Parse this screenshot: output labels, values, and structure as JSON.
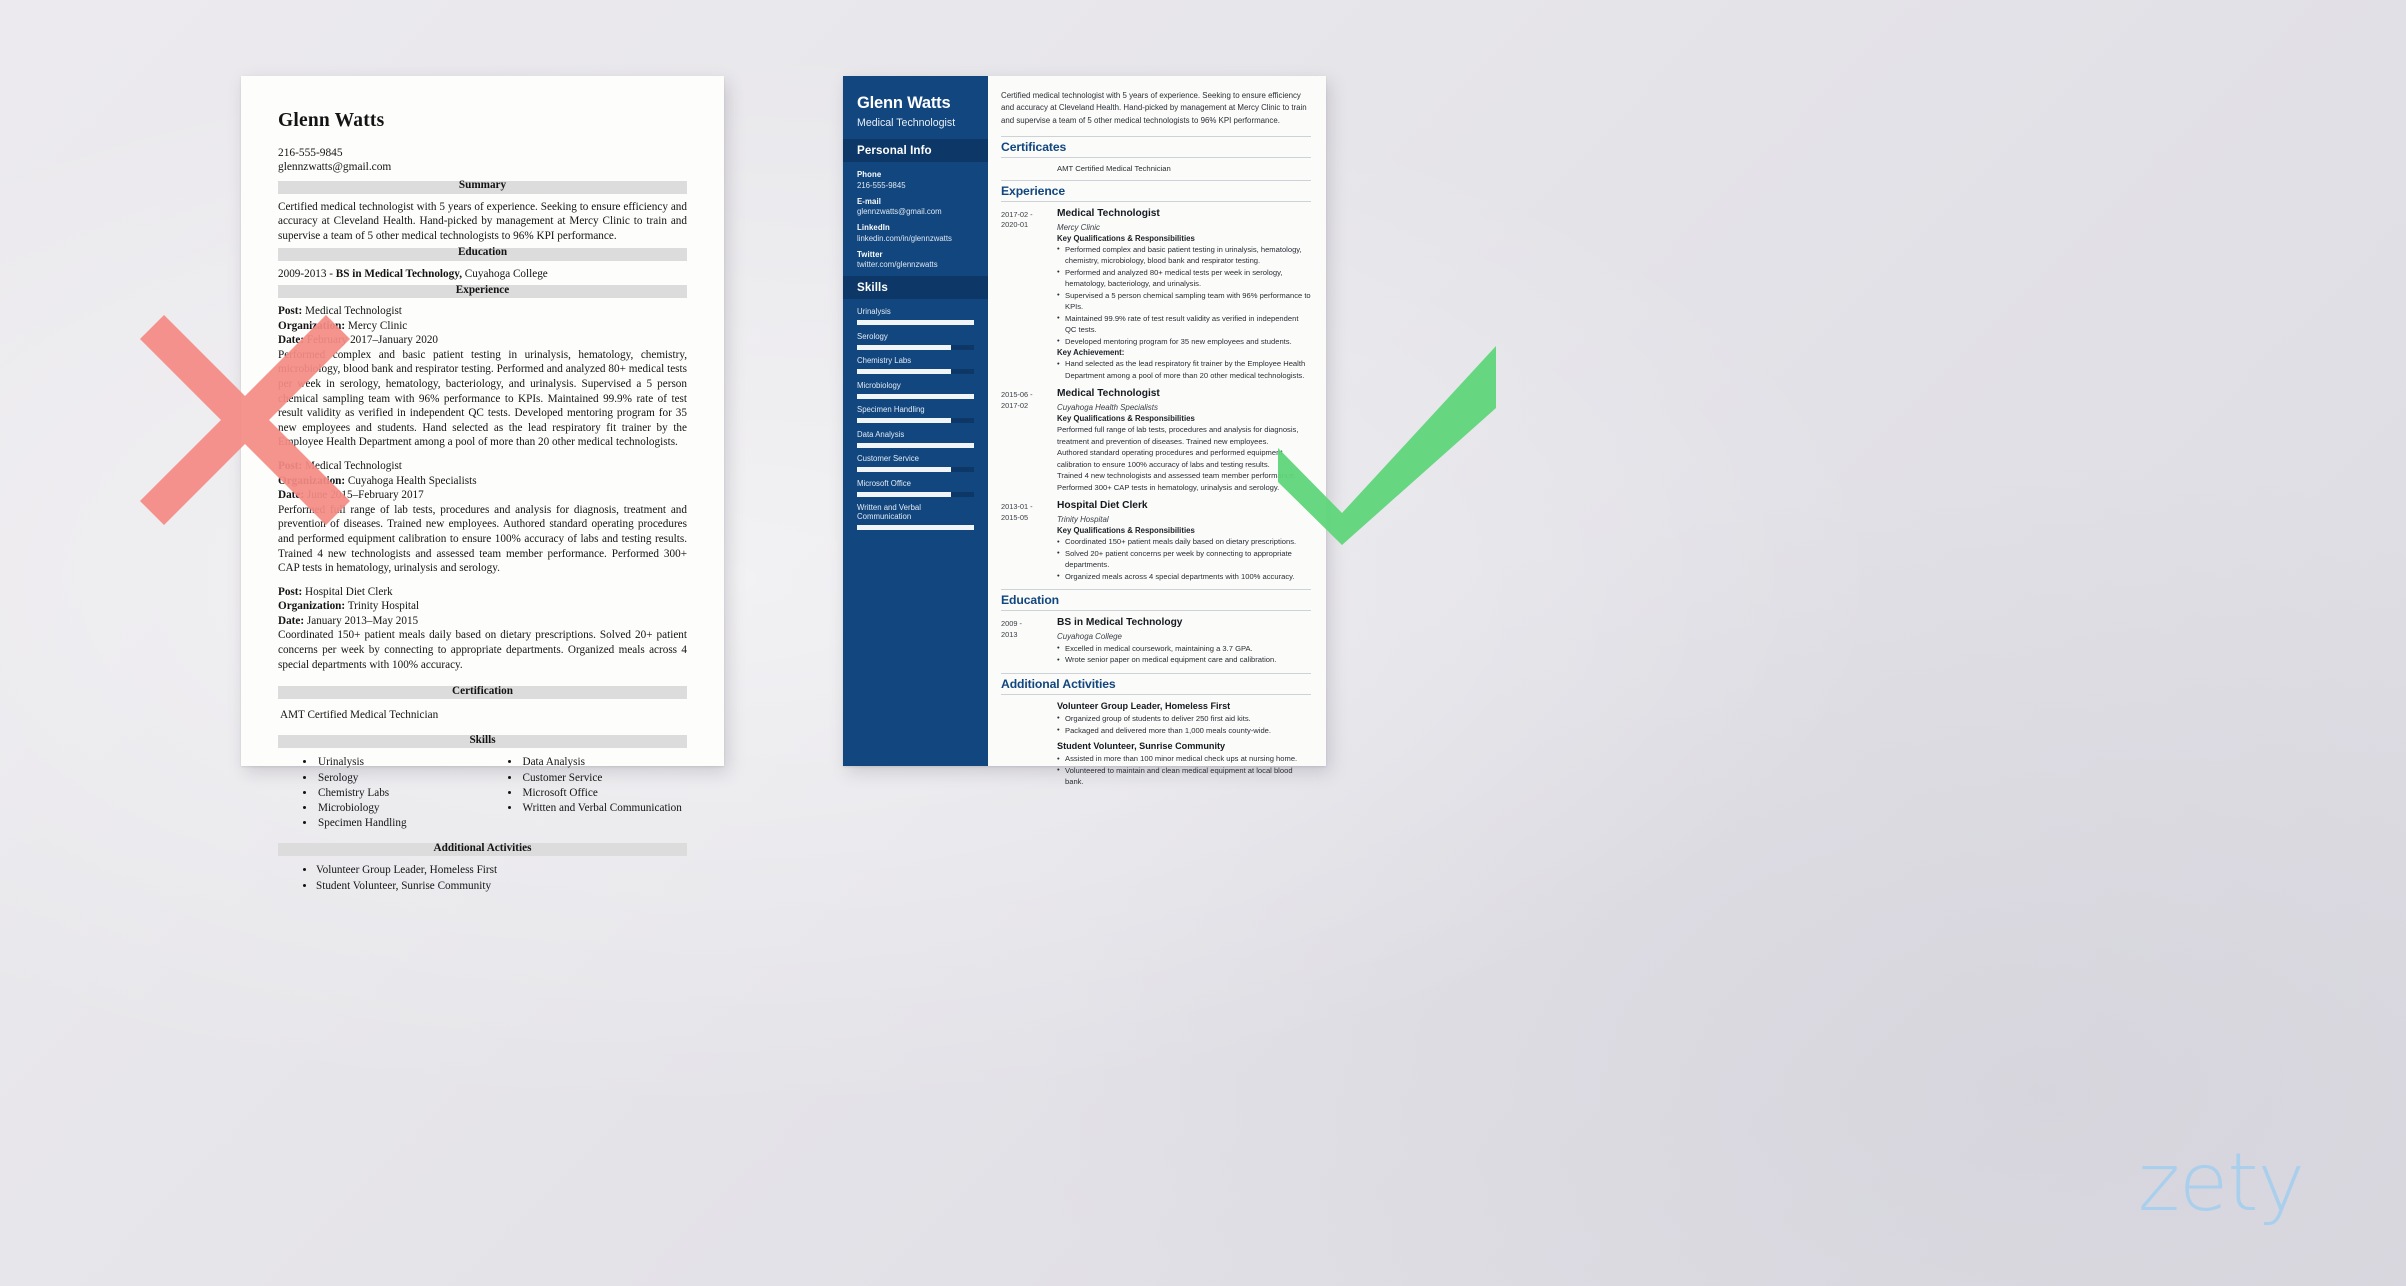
{
  "theme": {
    "accent_blue": "#11467f",
    "sidebar_dark": "#0c3766",
    "mark_bad": "#f58b85",
    "mark_good": "#5fd67a",
    "logo_blue": "#a8cfee"
  },
  "logo": {
    "text": "zety"
  },
  "bad_resume": {
    "name": "Glenn Watts",
    "phone": "216-555-9845",
    "email": "glennzwatts@gmail.com",
    "sections": {
      "summary": "Summary",
      "education": "Education",
      "experience": "Experience",
      "certification": "Certification",
      "skills": "Skills",
      "additional": "Additional Activities"
    },
    "summary_text": "Certified medical technologist with 5 years of experience. Seeking to ensure efficiency and accuracy at Cleveland Health. Hand-picked by management at Mercy Clinic to train and supervise a team of 5 other medical technologists to 96% KPI performance.",
    "education_years": "2009-2013 - ",
    "education_degree": "BS in Medical Technology,",
    "education_school": " Cuyahoga College",
    "labels": {
      "post": "Post:",
      "organization": "Organization:",
      "date": "Date:"
    },
    "jobs": [
      {
        "post": " Medical Technologist",
        "organization": " Mercy Clinic",
        "date": " February 2017–January 2020",
        "body": "Performed complex and basic patient testing in urinalysis, hematology, chemistry, microbiology, blood bank and respirator testing. Performed and analyzed 80+ medical tests per week in serology, hematology, bacteriology, and urinalysis. Supervised a 5 person chemical sampling team with 96% performance to KPIs. Maintained 99.9% rate of test result validity as verified in independent QC tests. Developed mentoring program for 35 new employees and students. Hand selected as the lead respiratory fit trainer by the Employee Health Department among a pool of more than 20 other medical technologists."
      },
      {
        "post": " Medical Technologist",
        "organization": " Cuyahoga Health Specialists",
        "date": " June 2015–February 2017",
        "body": "Performed full range of lab tests, procedures and analysis for diagnosis, treatment and prevention of diseases. Trained new employees. Authored standard operating procedures and performed equipment calibration to ensure 100% accuracy of labs and testing results. Trained 4 new technologists and assessed team member performance. Performed 300+ CAP tests in hematology, urinalysis and serology."
      },
      {
        "post": " Hospital Diet Clerk",
        "organization": " Trinity Hospital",
        "date": " January 2013–May 2015",
        "body": "Coordinated 150+ patient meals daily based on dietary prescriptions. Solved 20+ patient concerns per week by connecting to appropriate departments. Organized meals across 4 special departments with 100% accuracy."
      }
    ],
    "certification_text": "AMT Certified Medical Technician",
    "skills_col1": [
      "Urinalysis",
      "Serology",
      "Chemistry Labs",
      "Microbiology",
      "Specimen Handling"
    ],
    "skills_col2": [
      "Data Analysis",
      "Customer Service",
      "Microsoft Office",
      "Written and Verbal Communication"
    ],
    "activities": [
      "Volunteer Group Leader, Homeless First",
      "Student Volunteer, Sunrise Community"
    ]
  },
  "good_resume": {
    "name": "Glenn Watts",
    "job_title": "Medical Technologist",
    "sidebar": {
      "personal_info_heading": "Personal Info",
      "skills_heading": "Skills",
      "fields": [
        {
          "label": "Phone",
          "value": "216-555-9845"
        },
        {
          "label": "E-mail",
          "value": "glennzwatts@gmail.com"
        },
        {
          "label": "LinkedIn",
          "value": "linkedin.com/in/glennzwatts"
        },
        {
          "label": "Twitter",
          "value": "twitter.com/glennzwatts"
        }
      ],
      "skills": [
        {
          "name": "Urinalysis",
          "level": 100
        },
        {
          "name": "Serology",
          "level": 80
        },
        {
          "name": "Chemistry Labs",
          "level": 80
        },
        {
          "name": "Microbiology",
          "level": 100
        },
        {
          "name": "Specimen Handling",
          "level": 80
        },
        {
          "name": "Data Analysis",
          "level": 100
        },
        {
          "name": "Customer Service",
          "level": 80
        },
        {
          "name": "Microsoft Office",
          "level": 80
        },
        {
          "name": "Written and Verbal Communication",
          "level": 100
        }
      ]
    },
    "summary_text": "Certified medical technologist with 5 years of experience. Seeking to ensure efficiency and accuracy at Cleveland Health. Hand-picked by management at Mercy Clinic to train and supervise a team of 5 other medical technologists to 96% KPI performance.",
    "headings": {
      "certificates": "Certificates",
      "experience": "Experience",
      "education": "Education",
      "additional": "Additional Activities"
    },
    "certificate_text": "AMT Certified Medical Technician",
    "sub_labels": {
      "key_qualifications": "Key Qualifications & Responsibilities",
      "key_achievement": "Key Achievement:"
    },
    "experience": [
      {
        "date_from": "2017-02 -",
        "date_to": "2020-01",
        "title": "Medical Technologist",
        "org": "Mercy Clinic",
        "bullets": [
          "Performed complex and basic patient testing in urinalysis, hematology, chemistry, microbiology, blood bank and respirator testing.",
          "Performed and analyzed 80+ medical tests per week in serology, hematology, bacteriology, and urinalysis.",
          "Supervised a 5 person chemical sampling team with 96% performance to KPIs.",
          "Maintained 99.9% rate of test result validity as verified in independent QC tests.",
          "Developed mentoring program for 35 new employees and students."
        ],
        "achievement": [
          "Hand selected as the lead respiratory fit trainer by the Employee Health Department among a pool of more than 20 other medical technologists."
        ]
      },
      {
        "date_from": "2015-06 -",
        "date_to": "2017-02",
        "title": "Medical Technologist",
        "org": "Cuyahoga Health Specialists",
        "plain": [
          "Performed full range of lab tests, procedures and analysis for diagnosis, treatment and prevention of diseases. Trained new employees.",
          "Authored standard operating procedures and performed equipment calibration to ensure 100% accuracy of labs and testing results.",
          "Trained 4 new technologists and assessed team member performance.",
          "Performed 300+ CAP tests in hematology, urinalysis and serology."
        ]
      },
      {
        "date_from": "2013-01 -",
        "date_to": "2015-05",
        "title": "Hospital Diet Clerk",
        "org": "Trinity Hospital",
        "bullets": [
          "Coordinated 150+ patient meals daily based on dietary prescriptions.",
          "Solved 20+ patient concerns per week by connecting to appropriate departments.",
          "Organized meals across 4 special departments with 100% accuracy."
        ]
      }
    ],
    "education": [
      {
        "date_from": "2009 -",
        "date_to": "2013",
        "title": "BS in Medical Technology",
        "org": "Cuyahoga College",
        "bullets": [
          "Excelled in medical coursework, maintaining a 3.7 GPA.",
          "Wrote senior paper on medical equipment care and calibration."
        ]
      }
    ],
    "activities": [
      {
        "title": "Volunteer Group Leader, Homeless First",
        "bullets": [
          "Organized group of students to deliver 250 first aid kits.",
          "Packaged and delivered more than 1,000 meals county-wide."
        ]
      },
      {
        "title": "Student Volunteer, Sunrise Community",
        "bullets": [
          "Assisted in more than 100 minor medical check ups at nursing home.",
          "Volunteered to maintain and clean medical equipment at local blood bank."
        ]
      }
    ]
  }
}
